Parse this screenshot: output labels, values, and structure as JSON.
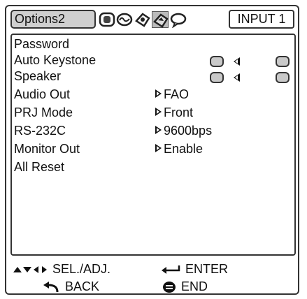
{
  "header": {
    "active_tab": "Options2",
    "tab_icons": [
      "picture-adjust-icon",
      "sync-adjust-icon",
      "fine-sync-icon",
      "options1-icon",
      "language-icon"
    ],
    "input_label": "INPUT 1"
  },
  "menu": {
    "items": [
      {
        "label": "Password",
        "value": ""
      },
      {
        "label": "Auto Keystone",
        "value": ""
      },
      {
        "label": "Speaker",
        "value": ""
      },
      {
        "label": "Audio Out",
        "value": "FAO"
      },
      {
        "label": "PRJ Mode",
        "value": "Front"
      },
      {
        "label": "RS-232C",
        "value": "9600bps"
      },
      {
        "label": "Monitor Out",
        "value": "Enable"
      },
      {
        "label": "All Reset",
        "value": ""
      }
    ]
  },
  "footer": {
    "sel_label": "SEL./ADJ.",
    "enter_label": "ENTER",
    "back_label": "BACK",
    "end_label": "END"
  }
}
